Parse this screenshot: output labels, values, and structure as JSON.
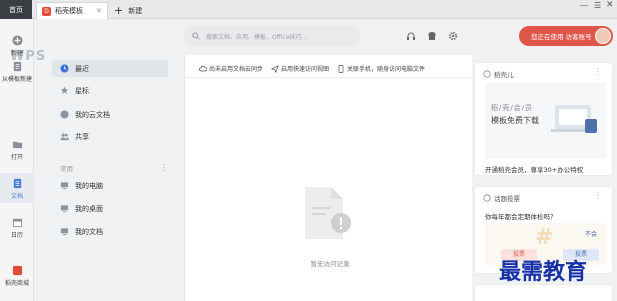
{
  "tabs": {
    "home": "首页",
    "doc": "稻壳模板",
    "new": "新建"
  },
  "logo": "WPS",
  "rail": [
    {
      "label": "新建",
      "icon": "plus-circle-icon"
    },
    {
      "label": "从模板新建",
      "icon": "template-icon"
    },
    {
      "label": "打开",
      "icon": "folder-icon"
    },
    {
      "label": "文档",
      "icon": "document-icon"
    },
    {
      "label": "日历",
      "icon": "calendar-icon"
    },
    {
      "label": "稻壳商城",
      "icon": "docer-store-icon"
    }
  ],
  "search": {
    "placeholder": "搜索文档、应用、模板、Office技巧..."
  },
  "user": {
    "button_label": "您正在使用 访客账号"
  },
  "nav": {
    "items": [
      {
        "label": "最近",
        "icon": "clock-icon"
      },
      {
        "label": "星标",
        "icon": "star-icon"
      },
      {
        "label": "我的云文档",
        "icon": "cloud-icon"
      },
      {
        "label": "共享",
        "icon": "share-users-icon"
      }
    ],
    "section_label": "常用",
    "common": [
      {
        "label": "我的电脑",
        "icon": "computer-icon"
      },
      {
        "label": "我的桌面",
        "icon": "desktop-icon"
      },
      {
        "label": "我的文档",
        "icon": "mydocs-icon"
      }
    ]
  },
  "main": {
    "actions": [
      "尚未启用文档云同步",
      "启用快速访问视图",
      "关联手机，随身访问电脑文件"
    ],
    "empty_text": "暂无访问记录"
  },
  "right": {
    "card1": {
      "title": "稻壳儿",
      "promo_line1": "稻/壳/会/员",
      "promo_line2": "模板免费下载",
      "footer": "开通稻壳会员，尊享30+办公特权"
    },
    "card2": {
      "title": "话题投票",
      "question": "你每年都会定期体检吗？",
      "left_label": "投票",
      "right_label": "投票",
      "right_hint": "不会"
    }
  },
  "watermark": "最需教育",
  "colors": {
    "accent": "#e0564a",
    "rail_active": "#e6e9ee",
    "watermark": "#1631a6"
  }
}
